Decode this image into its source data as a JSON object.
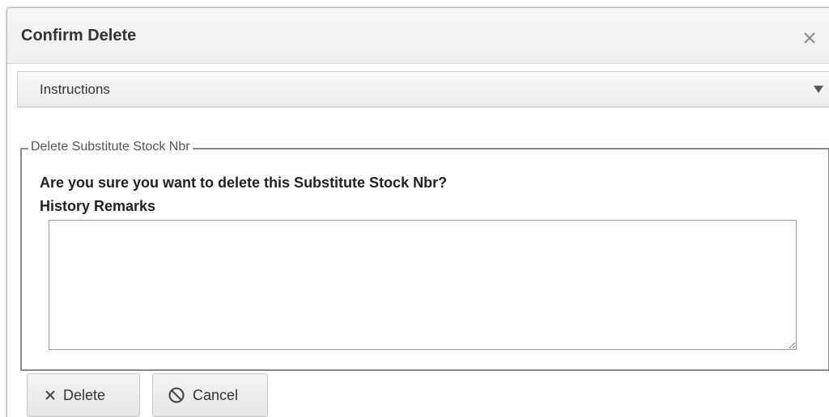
{
  "dialog": {
    "title": "Confirm Delete",
    "close_icon": "close-icon"
  },
  "instructions": {
    "label": "Instructions",
    "toggle_icon": "caret-down-icon"
  },
  "form": {
    "legend": "Delete Substitute Stock Nbr",
    "question": "Are you sure you want to delete this Substitute Stock Nbr?",
    "remarks_label": "History Remarks",
    "remarks_value": ""
  },
  "buttons": {
    "delete_label": "Delete",
    "delete_icon": "x-icon",
    "cancel_label": "Cancel",
    "cancel_icon": "prohibited-icon"
  }
}
